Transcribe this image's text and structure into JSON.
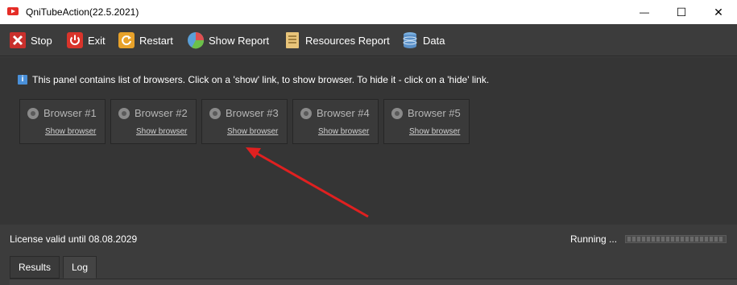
{
  "window": {
    "title": "QniTubeAction(22.5.2021)",
    "minimize_glyph": "—",
    "maximize_glyph": "☐",
    "close_glyph": "✕"
  },
  "toolbar": {
    "items": [
      {
        "label": "Stop",
        "icon": "stop-icon"
      },
      {
        "label": "Exit",
        "icon": "power-icon"
      },
      {
        "label": "Restart",
        "icon": "restart-icon"
      },
      {
        "label": "Show Report",
        "icon": "pie-chart-icon"
      },
      {
        "label": "Resources Report",
        "icon": "document-icon"
      },
      {
        "label": "Data",
        "icon": "database-icon"
      }
    ]
  },
  "info": {
    "icon_glyph": "i",
    "text": "This panel contains list of browsers. Click on a 'show' link, to show browser. To hide it - click on a 'hide' link."
  },
  "browsers": [
    {
      "name": "Browser #1",
      "link": "Show browser"
    },
    {
      "name": "Browser #2",
      "link": "Show browser"
    },
    {
      "name": "Browser #3",
      "link": "Show browser"
    },
    {
      "name": "Browser #4",
      "link": "Show browser"
    },
    {
      "name": "Browser #5",
      "link": "Show browser"
    }
  ],
  "splitter_glyph": "......",
  "status": {
    "license": "License valid until 08.08.2029",
    "running": "Running ..."
  },
  "tabs": [
    {
      "label": "Results",
      "active": false
    },
    {
      "label": "Log",
      "active": true
    }
  ],
  "colors": {
    "arrow": "#e02020",
    "background": "#353535",
    "toolbar": "#3c3c3c"
  }
}
